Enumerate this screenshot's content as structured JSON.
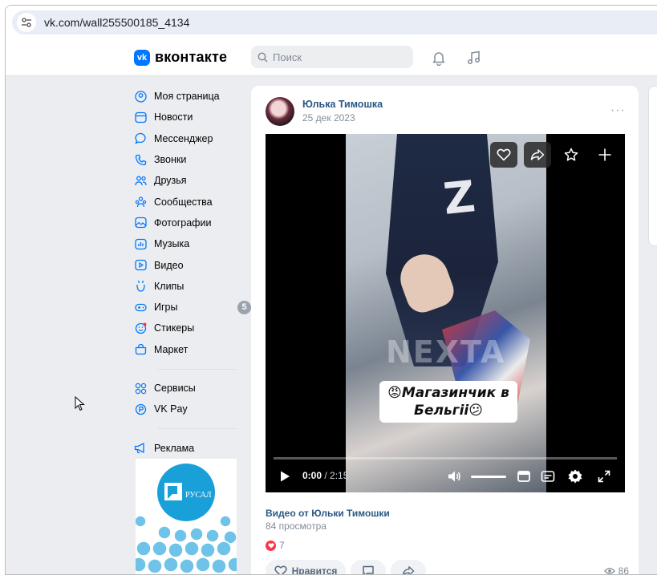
{
  "browser": {
    "url": "vk.com/wall255500185_4134"
  },
  "header": {
    "logo_mark": "vk",
    "logo_text": "вконтакте",
    "search_placeholder": "Поиск"
  },
  "sidebar": {
    "items": [
      {
        "label": "Моя страница",
        "icon": "user-circle-icon"
      },
      {
        "label": "Новости",
        "icon": "news-icon"
      },
      {
        "label": "Мессенджер",
        "icon": "chat-bubble-icon"
      },
      {
        "label": "Звонки",
        "icon": "phone-icon"
      },
      {
        "label": "Друзья",
        "icon": "friends-icon"
      },
      {
        "label": "Сообщества",
        "icon": "communities-icon"
      },
      {
        "label": "Фотографии",
        "icon": "photo-icon"
      },
      {
        "label": "Музыка",
        "icon": "music-icon"
      },
      {
        "label": "Видео",
        "icon": "video-icon"
      },
      {
        "label": "Клипы",
        "icon": "clips-icon"
      },
      {
        "label": "Игры",
        "icon": "gamepad-icon",
        "badge": "5"
      },
      {
        "label": "Стикеры",
        "icon": "sticker-icon"
      },
      {
        "label": "Маркет",
        "icon": "bag-icon"
      }
    ],
    "secondary": [
      {
        "label": "Сервисы",
        "icon": "services-icon"
      },
      {
        "label": "VK Pay",
        "icon": "vkpay-icon"
      }
    ],
    "tertiary": [
      {
        "label": "Реклама",
        "icon": "megaphone-icon"
      }
    ],
    "ad_logo_text": "РУСАЛ"
  },
  "post": {
    "author": "Юлька Тимошка",
    "date": "25 дек 2023",
    "more": "···",
    "video": {
      "caption_line1": "😡Магазинчик в",
      "caption_line2": "Бельгii😕",
      "watermark": "NEXTA",
      "time_current": "0:00",
      "time_total": " / 2:15",
      "progress_fraction": 0
    },
    "video_title": "Видео от Юльки Тимошки",
    "video_views": "84 просмотра",
    "likes_count": "7",
    "like_label": "Нравится",
    "views_count": "86"
  },
  "colors": {
    "accent": "#0077ff",
    "link": "#2a5885",
    "background": "#ebedf0",
    "like_red": "#ff3347"
  }
}
